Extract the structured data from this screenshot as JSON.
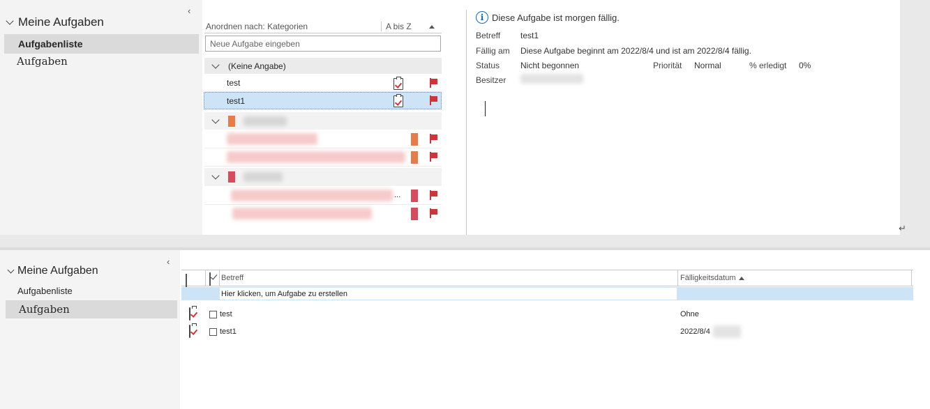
{
  "top": {
    "sidebar": {
      "title": "Meine Aufgaben",
      "items": [
        {
          "label": "Aufgabenliste"
        },
        {
          "label": "Aufgaben"
        }
      ]
    },
    "list": {
      "arrange_label": "Anordnen nach: Kategorien",
      "sort_label": "A bis Z",
      "new_task_placeholder": "Neue Aufgabe eingeben",
      "group_none": "(Keine Angabe)",
      "tasks": [
        {
          "subject": "test"
        },
        {
          "subject": "test1"
        }
      ],
      "ellipsis": "..."
    },
    "detail": {
      "info_banner": "Diese Aufgabe ist morgen fällig.",
      "subject_label": "Betreff",
      "subject_value": "test1",
      "due_label": "Fällig am",
      "due_value": "Diese Aufgabe beginnt am 2022/8/4 und ist am 2022/8/4 fällig.",
      "status_label": "Status",
      "status_value": "Nicht begonnen",
      "priority_label": "Priorität",
      "priority_value": "Normal",
      "percent_label": "% erledigt",
      "percent_value": "0%",
      "owner_label": "Besitzer"
    }
  },
  "bottom": {
    "sidebar": {
      "title": "Meine Aufgaben",
      "items": [
        {
          "label": "Aufgabenliste"
        },
        {
          "label": "Aufgaben"
        }
      ]
    },
    "table": {
      "col_subject": "Betreff",
      "col_due": "Fälligkeitsdatum",
      "new_row_text": "Hier klicken, um Aufgabe zu erstellen",
      "rows": [
        {
          "subject": "test",
          "due": "Ohne"
        },
        {
          "subject": "test1",
          "due": "2022/8/4"
        }
      ]
    }
  },
  "colors": {
    "accent": "#0f6cbd",
    "flag": "#d13438",
    "selected_row": "#cde4f7",
    "category_orange": "#e97b4a",
    "category_red": "#d94a5c"
  }
}
